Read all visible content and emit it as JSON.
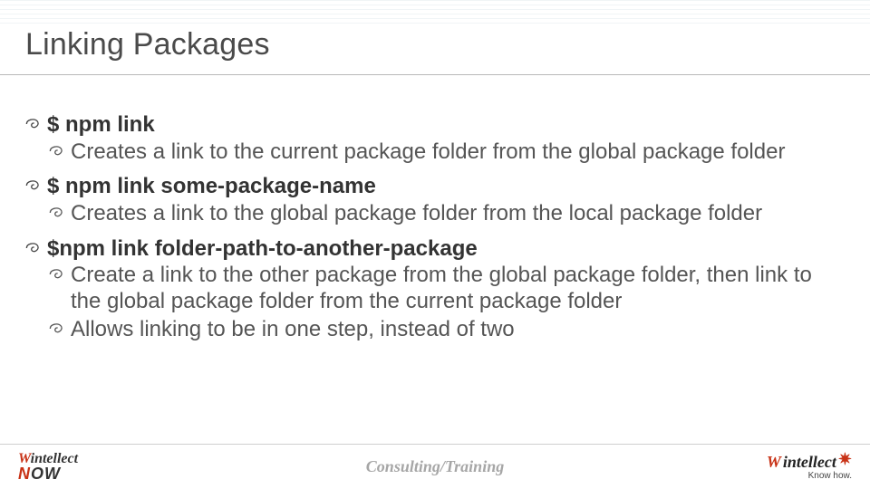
{
  "title": "Linking Packages",
  "groups": [
    {
      "cmd": "$ npm link",
      "subs": [
        "Creates a link to the current package folder from the global package folder"
      ]
    },
    {
      "cmd": "$ npm link some-package-name",
      "subs": [
        "Creates a link to the global package folder from the local package folder"
      ]
    },
    {
      "cmd": "$npm link folder-path-to-another-package",
      "subs": [
        "Create a link to the other package from the global package folder, then link to the global package folder from the current package folder",
        "Allows linking to be in one step, instead of two"
      ]
    }
  ],
  "footer": {
    "center": "Consulting/Training",
    "left_brand_main": "Wintellect",
    "left_brand_sub": "NOW",
    "right_brand": "Wintellect",
    "right_tag": "Know how."
  }
}
